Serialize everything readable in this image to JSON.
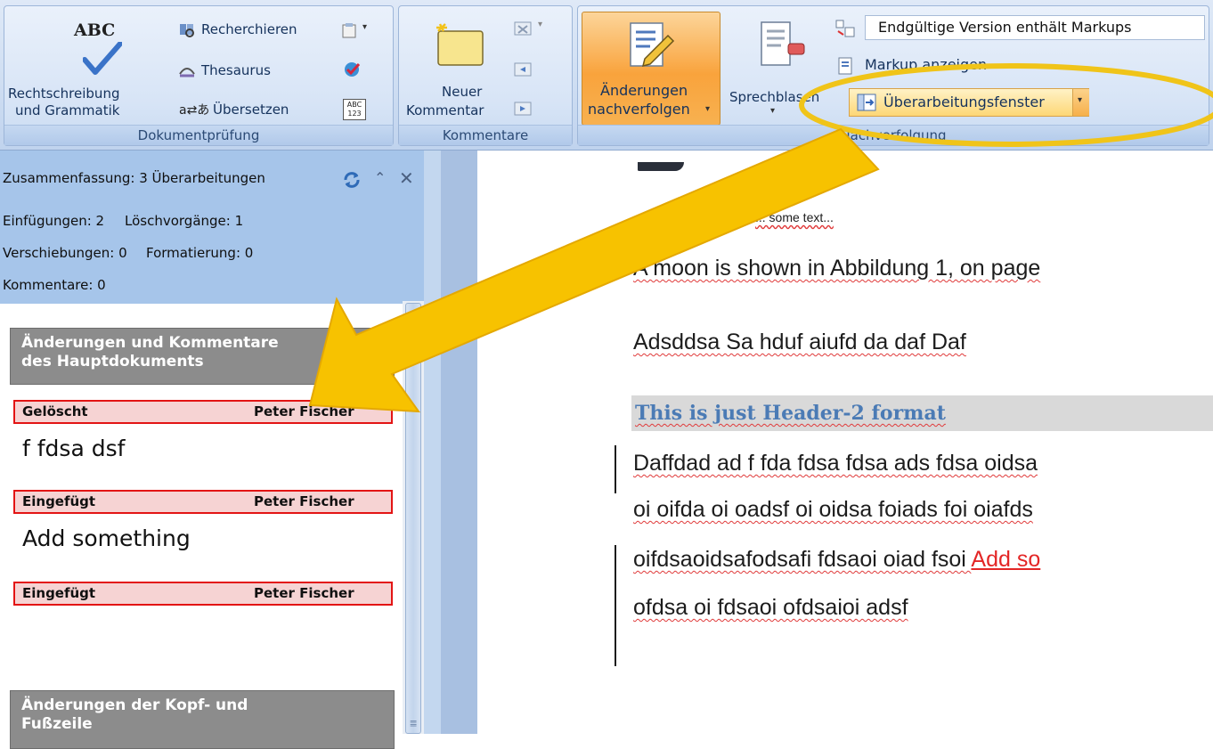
{
  "ribbon": {
    "groups": {
      "dokumentpruefung": {
        "label": "Dokumentprüfung",
        "spelling_icon_text": "ABC",
        "spelling_line1": "Rechtschreibung",
        "spelling_line2": "und Grammatik",
        "research": "Recherchieren",
        "thesaurus": "Thesaurus",
        "translate": "Übersetzen",
        "wordcount_icon_text": "ABC 123"
      },
      "kommentare": {
        "label": "Kommentare",
        "new_comment_line1": "Neuer",
        "new_comment_line2": "Kommentar"
      },
      "nachverfolgung": {
        "label": "Nachverfolgung",
        "track_changes_line1": "Änderungen",
        "track_changes_line2": "nachverfolgen",
        "balloons": "Sprechblasen",
        "display_for_review": "Endgültige Version enthält Markups",
        "show_markup": "Markup anzeigen",
        "reviewing_pane": "Überarbeitungsfenster"
      }
    }
  },
  "review_pane": {
    "summary": "Zusammenfassung: 3 Überarbeitungen",
    "stats": {
      "insertions": "Einfügungen: 2",
      "deletions": "Löschvorgänge: 1",
      "moves": "Verschiebungen: 0",
      "formatting": "Formatierung: 0",
      "comments": "Kommentare: 0"
    },
    "main_section_line1": "Änderungen und Kommentare",
    "main_section_line2": "des Hauptdokuments",
    "revisions": [
      {
        "type": "Gelöscht",
        "author": "Peter Fischer",
        "text": "f  fdsa dsf"
      },
      {
        "type": "Eingefügt",
        "author": "Peter Fischer",
        "text": "Add something"
      },
      {
        "type": "Eingefügt",
        "author": "Peter Fischer",
        "text": ""
      }
    ],
    "header_section_line1": "Änderungen der Kopf- und",
    "header_section_line2": "Fußzeile"
  },
  "document": {
    "caption": "... some text...",
    "line1": "A moon is shown in Abbildung 1, on page",
    "line2": "Adsddsa Sa hduf aiufd  da daf Daf",
    "heading": "This is just Header-2 format",
    "para": [
      "Daffdad ad f fda  fdsa fdsa ads fdsa oidsa",
      "oi oifda oi oadsf oi oidsa foiads foi oiafds",
      "oifdsaoidsafodsafi  fdsaoi  oiad  fsoi ",
      "ofdsa oi fdsaoi  ofdsaioi adsf"
    ],
    "inserted_text": "Add so"
  },
  "colors": {
    "annotation_arrow": "#f7c200",
    "annotation_ellipse": "#f0c419",
    "revision_border": "#e31414",
    "revision_fill": "#f6d3d3",
    "pane_header": "#a6c5ea",
    "heading_color": "#4b7bb5",
    "track_changes_active": "#f9a33c"
  }
}
